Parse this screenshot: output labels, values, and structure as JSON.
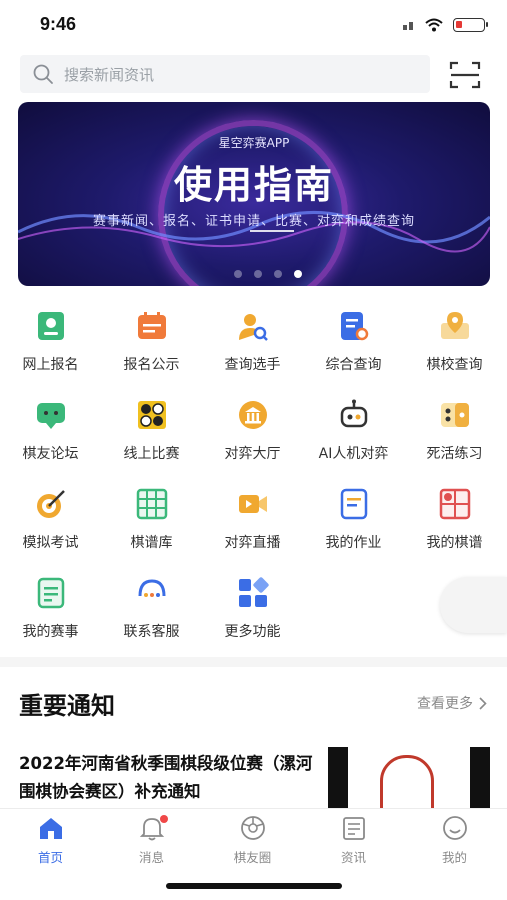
{
  "status": {
    "time": "9:46"
  },
  "search": {
    "placeholder": "搜索新闻资讯"
  },
  "banner": {
    "subtitle": "星空弈赛APP",
    "title": "使用指南",
    "description": "赛事新闻、报名、证书申请、比赛、对弈和成绩查询",
    "slide_count": 4,
    "active_slide": 4
  },
  "grid": {
    "items": [
      {
        "label": "网上报名",
        "icon": "registration-icon",
        "color": "#3bb87a"
      },
      {
        "label": "报名公示",
        "icon": "notice-board-icon",
        "color": "#f07a3a"
      },
      {
        "label": "查询选手",
        "icon": "search-player-icon",
        "color": "#f0a830"
      },
      {
        "label": "综合查询",
        "icon": "document-search-icon",
        "color": "#3b6de5"
      },
      {
        "label": "棋校查询",
        "icon": "location-map-icon",
        "color": "#f0b040"
      },
      {
        "label": "棋友论坛",
        "icon": "chat-icon",
        "color": "#3bb87a"
      },
      {
        "label": "线上比赛",
        "icon": "go-board-icon",
        "color": "#f0c020"
      },
      {
        "label": "对弈大厅",
        "icon": "hall-icon",
        "color": "#f0a830"
      },
      {
        "label": "AI人机对弈",
        "icon": "robot-icon",
        "color": "#333333"
      },
      {
        "label": "死活练习",
        "icon": "practice-icon",
        "color": "#f0b040"
      },
      {
        "label": "模拟考试",
        "icon": "target-icon",
        "color": "#f0a830"
      },
      {
        "label": "棋谱库",
        "icon": "game-record-icon",
        "color": "#3bb87a"
      },
      {
        "label": "对弈直播",
        "icon": "video-icon",
        "color": "#f0a830"
      },
      {
        "label": "我的作业",
        "icon": "homework-icon",
        "color": "#3b6de5"
      },
      {
        "label": "我的棋谱",
        "icon": "my-record-icon",
        "color": "#e05050"
      },
      {
        "label": "我的赛事",
        "icon": "my-events-icon",
        "color": "#3bb87a"
      },
      {
        "label": "联系客服",
        "icon": "customer-service-icon",
        "color": "#3b6de5"
      },
      {
        "label": "更多功能",
        "icon": "more-apps-icon",
        "color": "#3b6de5"
      }
    ]
  },
  "notices": {
    "title": "重要通知",
    "see_more": "查看更多",
    "items": [
      {
        "title": "2022年河南省秋季围棋段级位赛（漯河围棋协会赛区）补充通知"
      }
    ]
  },
  "tabbar": {
    "items": [
      {
        "label": "首页",
        "icon": "home-icon",
        "active": true
      },
      {
        "label": "消息",
        "icon": "bell-icon",
        "badge": true
      },
      {
        "label": "棋友圈",
        "icon": "aperture-icon"
      },
      {
        "label": "资讯",
        "icon": "news-icon"
      },
      {
        "label": "我的",
        "icon": "profile-icon"
      }
    ]
  },
  "colors": {
    "accent": "#3b6de5",
    "badge": "#f04848"
  }
}
